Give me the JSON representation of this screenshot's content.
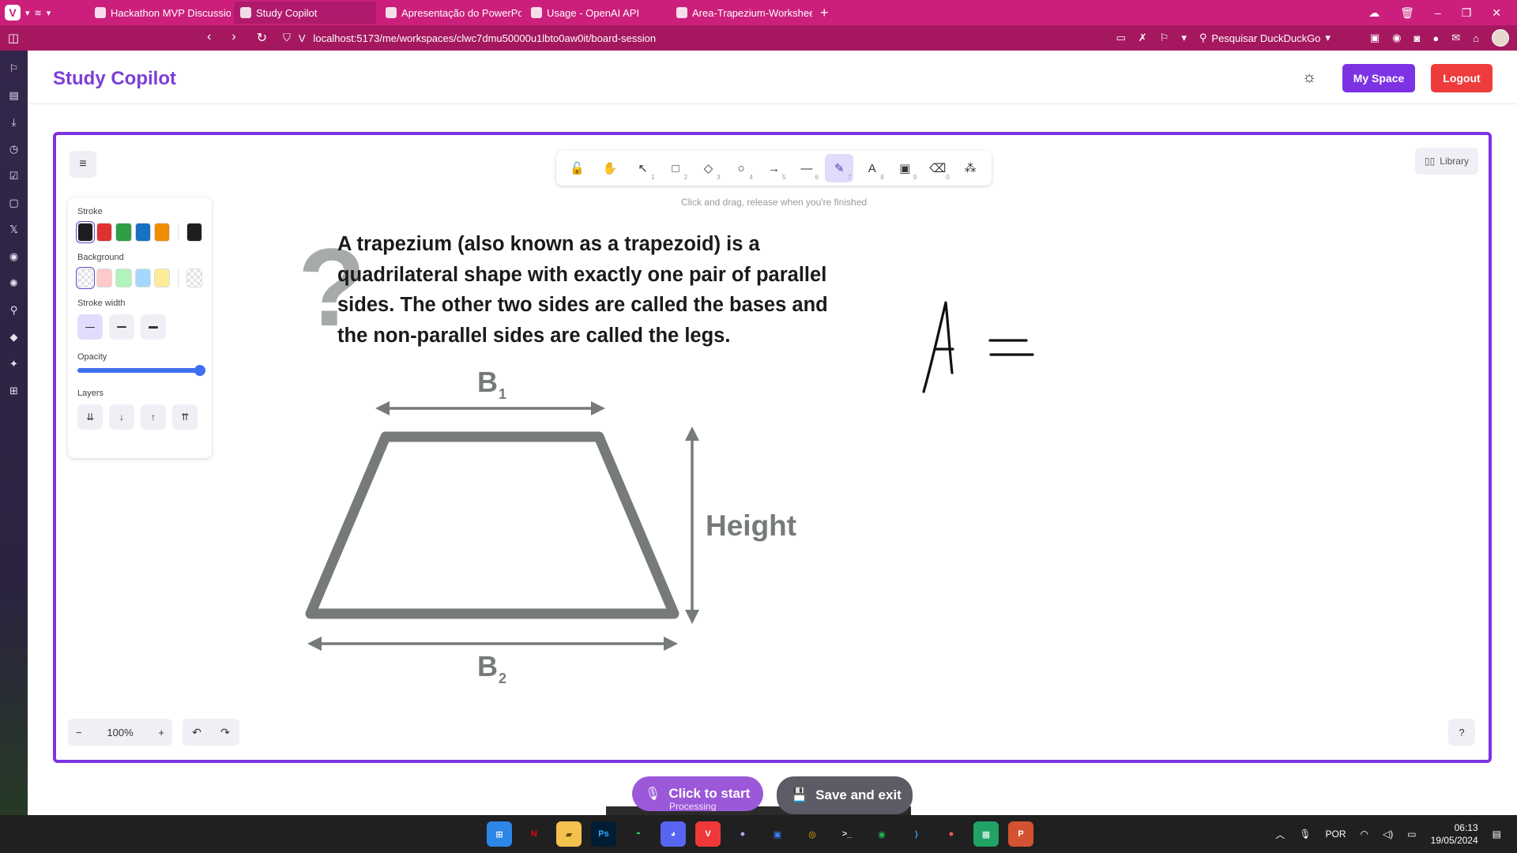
{
  "browser": {
    "tabs": [
      {
        "title": "Hackathon MVP Discussion",
        "active": false
      },
      {
        "title": "Study Copilot",
        "active": true
      },
      {
        "title": "Apresentação do PowerPoint",
        "active": false
      },
      {
        "title": "Usage - OpenAI API",
        "active": false
      },
      {
        "title": "Area-Trapezium-Worksheet",
        "active": false
      }
    ],
    "new_tab_glyph": "+",
    "url": "localhost:5173/me/workspaces/clwc7dmu50000u1lbto0aw0it/board-session",
    "search_placeholder": "Pesquisar DuckDuckGo",
    "accent_color": "#cb1f7b"
  },
  "app": {
    "brand": "Study Copilot",
    "brand_color": "#7b3fd6",
    "my_space_label": "My Space",
    "logout_label": "Logout",
    "logout_color": "#ee3c3c"
  },
  "toolbar": {
    "tools": [
      {
        "name": "lock",
        "glyph": "🔓",
        "key": ""
      },
      {
        "name": "hand",
        "glyph": "✋",
        "key": ""
      },
      {
        "name": "selection",
        "glyph": "↖",
        "key": "1"
      },
      {
        "name": "rectangle",
        "glyph": "□",
        "key": "2"
      },
      {
        "name": "diamond",
        "glyph": "◇",
        "key": "3"
      },
      {
        "name": "ellipse",
        "glyph": "○",
        "key": "4"
      },
      {
        "name": "arrow",
        "glyph": "→",
        "key": "5"
      },
      {
        "name": "line",
        "glyph": "—",
        "key": "6"
      },
      {
        "name": "draw",
        "glyph": "✎",
        "key": "7",
        "active": true
      },
      {
        "name": "text",
        "glyph": "A",
        "key": "8"
      },
      {
        "name": "image",
        "glyph": "▣",
        "key": "9"
      },
      {
        "name": "eraser",
        "glyph": "⌫",
        "key": "0"
      },
      {
        "name": "extra-tools",
        "glyph": "⁂",
        "key": ""
      }
    ],
    "hint": "Click and drag, release when you're finished",
    "library_label": "Library"
  },
  "properties": {
    "stroke_label": "Stroke",
    "stroke_colors": [
      "#1e1e1e",
      "#e03131",
      "#2f9e44",
      "#1971c2",
      "#f08c00"
    ],
    "stroke_current": "#1e1e1e",
    "background_label": "Background",
    "background_colors": [
      "transparent",
      "#ffc9c9",
      "#b2f2bb",
      "#a5d8ff",
      "#ffec99"
    ],
    "background_current": "transparent",
    "stroke_width_label": "Stroke width",
    "opacity_label": "Opacity",
    "opacity_value": 100,
    "layers_label": "Layers"
  },
  "canvas": {
    "description": "A trapezium (also known as a trapezoid) is a quadrilateral shape with exactly one pair of parallel sides. The other two sides are called the bases and the non-parallel sides are called the legs.",
    "label_top_base": "B",
    "label_top_sub": "1",
    "label_bottom_base": "B",
    "label_bottom_sub": "2",
    "label_height": "Height",
    "question_mark": "?",
    "shape_color": "#767b7a"
  },
  "footer": {
    "zoom": "100%",
    "start_label": "Click to start",
    "processing_label": "Processing",
    "save_label": "Save and exit"
  },
  "taskbar": {
    "language": "POR",
    "time": "06:13",
    "date": "19/05/2024"
  }
}
